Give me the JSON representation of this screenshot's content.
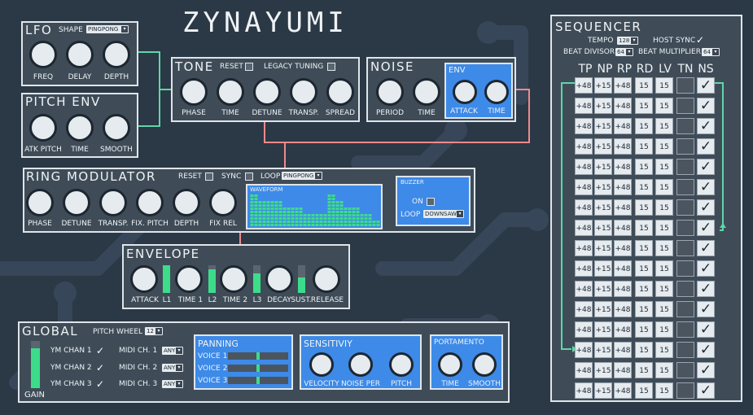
{
  "app_title": "ZYNAYUMI",
  "lfo": {
    "title": "LFO",
    "shape_label": "SHAPE",
    "shape_value": "PINGPONG",
    "knobs": [
      "FREQ",
      "DELAY",
      "DEPTH"
    ]
  },
  "pitch_env": {
    "title": "PITCH ENV",
    "knobs": [
      "ATK PITCH",
      "TIME",
      "SMOOTH"
    ]
  },
  "tone": {
    "title": "TONE",
    "reset_label": "RESET",
    "legacy_label": "LEGACY TUNING",
    "knobs": [
      "PHASE",
      "TIME",
      "DETUNE",
      "TRANSP.",
      "SPREAD"
    ]
  },
  "noise": {
    "title": "NOISE",
    "knobs": [
      "PERIOD",
      "TIME"
    ],
    "env_title": "ENV",
    "env_knobs": [
      "ATTACK",
      "TIME"
    ]
  },
  "ring": {
    "title": "RING MODULATOR",
    "reset_label": "RESET",
    "sync_label": "SYNC",
    "loop_label": "LOOP",
    "loop_value": "PINGPONG",
    "knobs": [
      "PHASE",
      "DETUNE",
      "TRANSP.",
      "FIX. PITCH",
      "DEPTH",
      "FIX  REL"
    ],
    "waveform_title": "WAVEFORM",
    "waveform_levels": [
      10,
      10,
      8,
      8,
      8,
      8,
      8,
      8,
      6,
      6,
      6,
      6,
      6,
      4,
      4,
      4,
      4,
      4,
      4,
      10,
      10,
      8,
      8,
      6,
      6,
      6,
      6,
      4,
      4,
      4,
      2,
      2
    ],
    "buzzer": {
      "title": "BUZZER",
      "on_label": "ON",
      "loop_label": "LOOP",
      "loop_value": "DOWNSAW"
    }
  },
  "envelope": {
    "title": "ENVELOPE",
    "labels": [
      "ATTACK",
      "L1",
      "TIME 1",
      "L2",
      "TIME 2",
      "L3",
      "DECAY",
      "SUST.",
      "RELEASE"
    ],
    "levels": [
      1.0,
      0.85,
      0.7,
      0.55
    ]
  },
  "global": {
    "title": "GLOBAL",
    "pitch_wheel_label": "PITCH WHEEL",
    "pitch_wheel_value": "12",
    "gain_label": "GAIN",
    "gain_level": 0.85,
    "channels": [
      {
        "label": "YM CHAN 1",
        "midi_label": "MIDI CH. 1",
        "midi_value": "ANY"
      },
      {
        "label": "YM CHAN 2",
        "midi_label": "MIDI CH. 2",
        "midi_value": "ANY"
      },
      {
        "label": "YM CHAN 3",
        "midi_label": "MIDI CH. 3",
        "midi_value": "ANY"
      }
    ],
    "panning": {
      "title": "PANNING",
      "voices": [
        {
          "label": "VOICE 1",
          "value": 0.5
        },
        {
          "label": "VOICE 2",
          "value": 0.5
        },
        {
          "label": "VOICE 3",
          "value": 0.5
        }
      ]
    },
    "sensitivity": {
      "title": "SENSITIVIY",
      "knobs": [
        "VELOCITY",
        "NOISE PER",
        "PITCH"
      ]
    },
    "portamento": {
      "title": "PORTAMENTO",
      "knobs": [
        "TIME",
        "SMOOTH"
      ]
    }
  },
  "sequencer": {
    "title": "SEQUENCER",
    "tempo_label": "TEMPO",
    "tempo_value": "128",
    "host_sync_label": "HOST SYNC",
    "beat_divisor_label": "BEAT DIVISOR",
    "beat_divisor_value": "64",
    "beat_multiplier_label": "BEAT MULTIPLIER",
    "beat_multiplier_value": "64",
    "columns": [
      "TP",
      "NP",
      "RP",
      "RD",
      "LV",
      "TN",
      "NS"
    ],
    "row_values": [
      "+48",
      "+15",
      "+48",
      "15",
      "15"
    ],
    "row_count": 16,
    "check_glyph": "✓",
    "colors": {
      "accent": "#3d8ae8",
      "level": "#3ddc8a",
      "loop_line": "#5fd6a8",
      "link_line": "#f08a8a"
    }
  }
}
